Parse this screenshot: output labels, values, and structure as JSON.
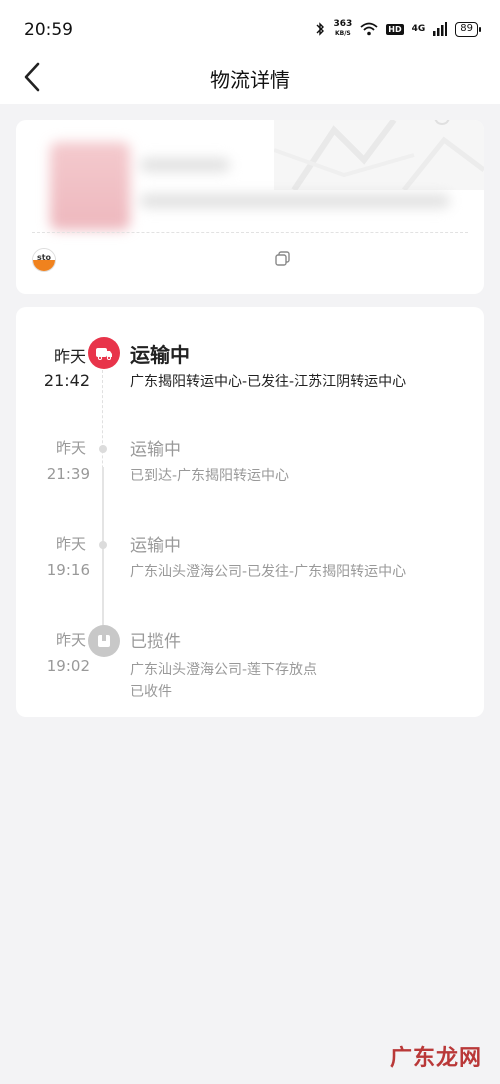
{
  "status_bar": {
    "time": "20:59",
    "speed_value": "363",
    "speed_unit": "KB/S",
    "hd": "HD",
    "network": "4G",
    "battery": "89"
  },
  "nav": {
    "title": "物流详情",
    "back_icon": "chevron-left-icon"
  },
  "package": {
    "carrier_logo_text": "sto",
    "copy_icon": "copy-icon"
  },
  "tracking": {
    "events": [
      {
        "day": "昨天",
        "time": "21:42",
        "status": "运输中",
        "desc": "广东揭阳转运中心-已发往-江苏江阴转运中心",
        "icon": "truck-icon",
        "active": true
      },
      {
        "day": "昨天",
        "time": "21:39",
        "status": "运输中",
        "desc": "已到达-广东揭阳转运中心",
        "icon": "dot-icon",
        "active": false
      },
      {
        "day": "昨天",
        "time": "19:16",
        "status": "运输中",
        "desc": "广东汕头澄海公司-已发往-广东揭阳转运中心",
        "icon": "dot-icon",
        "active": false
      },
      {
        "day": "昨天",
        "time": "19:02",
        "status": "已揽件",
        "desc_line1": "广东汕头澄海公司-莲下存放点",
        "desc_line2": "已收件",
        "icon": "parcel-icon",
        "active": false
      }
    ]
  },
  "watermark": "广东龙网",
  "colors": {
    "accent_red": "#e8344a",
    "carrier_orange": "#f0821e",
    "background": "#f3f3f5"
  }
}
